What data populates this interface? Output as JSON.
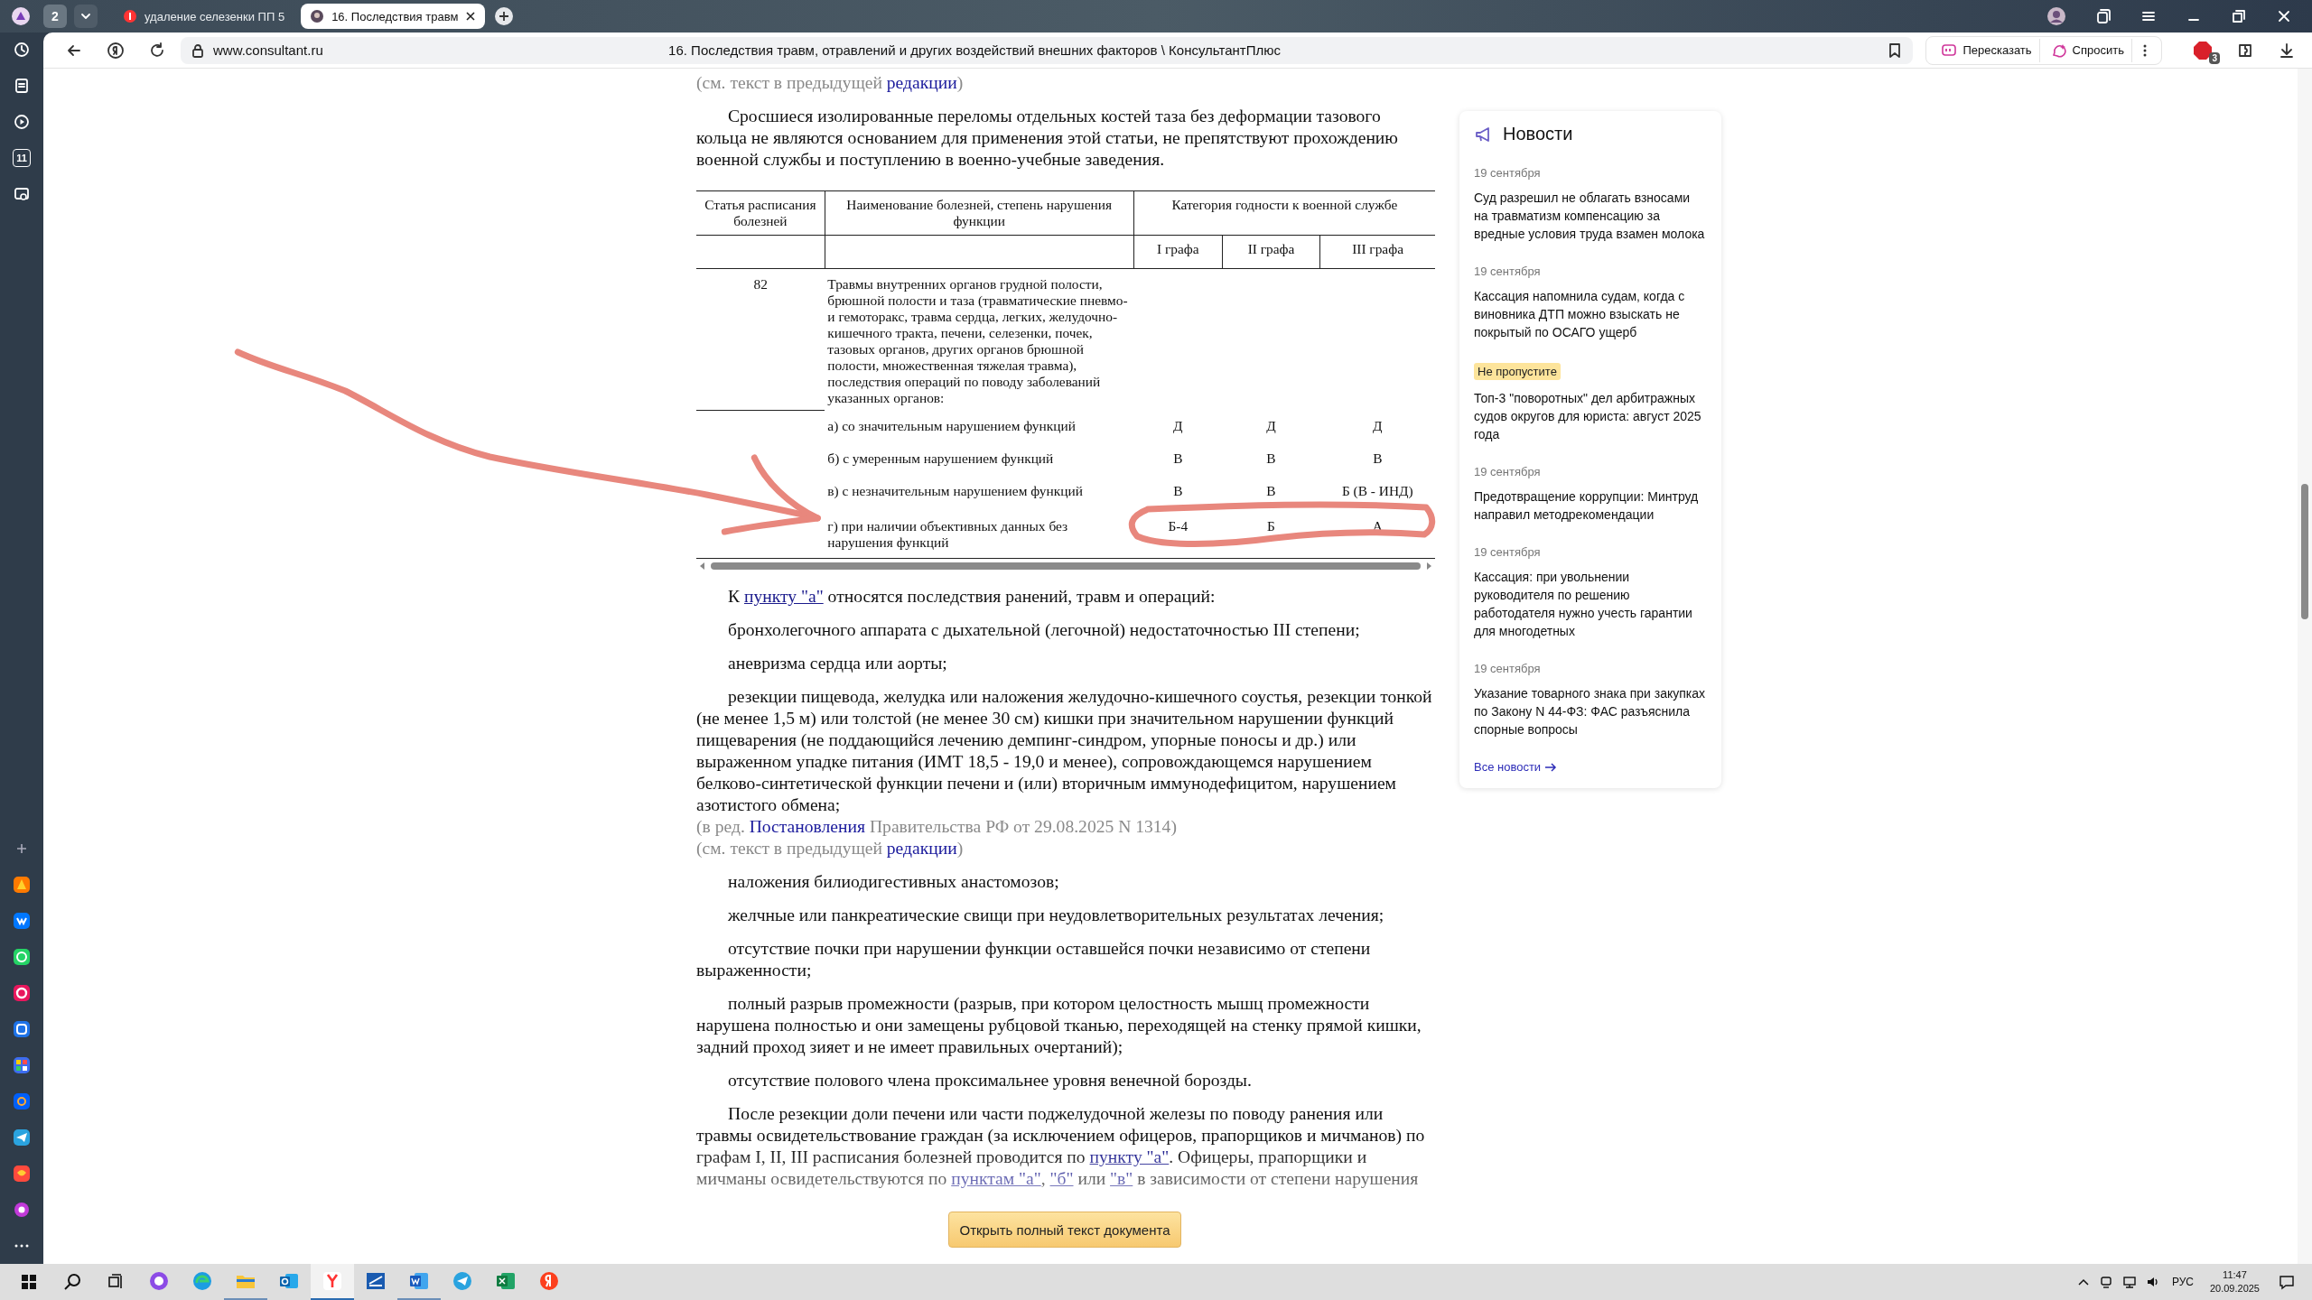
{
  "browser": {
    "tab_count": "2",
    "tabs": [
      {
        "title": "удаление селезенки ПП 5",
        "selected": false
      },
      {
        "title": "16. Последствия травм",
        "selected": true
      }
    ],
    "url": "www.consultant.ru",
    "page_title": "16. Последствия травм, отравлений и других воздействий внешних факторов \\ КонсультантПлюс",
    "actions": [
      "Пересказать",
      "Спросить"
    ],
    "extension_badge": "3"
  },
  "sidebar": {
    "calendar_day": "11"
  },
  "document": {
    "blocks": [
      {
        "kind": "note",
        "parts": [
          {
            "text": "(см. текст в предыдущей "
          },
          {
            "link": "редакции"
          },
          {
            "text": ")"
          }
        ]
      },
      {
        "kind": "para",
        "parts": [
          {
            "text": "Сросшиеся изолированные переломы отдельных костей таза без деформации тазового кольца не являются основанием для применения этой статьи, не препятствуют прохождению военной службы и поступлению в военно-учебные заведения."
          }
        ]
      },
      {
        "kind": "table"
      },
      {
        "kind": "para",
        "parts": [
          {
            "text": "К "
          },
          {
            "link": "пункту \"а\""
          },
          {
            "text": " относятся последствия ранений, травм и операций:"
          }
        ]
      },
      {
        "kind": "para",
        "parts": [
          {
            "text": "бронхолегочного аппарата с дыхательной (легочной) недостаточностью III степени;"
          }
        ]
      },
      {
        "kind": "para",
        "parts": [
          {
            "text": "аневризма сердца или аорты;"
          }
        ]
      },
      {
        "kind": "para",
        "parts": [
          {
            "text": "резекции пищевода, желудка или наложения желудочно-кишечного соустья, резекции тонкой (не менее 1,5 м) или толстой (не менее 30 см) кишки при значительном нарушении функций пищеварения (не поддающийся лечению демпинг-синдром, упорные поносы и др.) или выраженном упадке питания (ИМТ 18,5 - 19,0 и менее), сопровождающемся нарушением белково-синтетической функции печени и (или) вторичным иммунодефицитом, нарушением азотистого обмена;"
          }
        ]
      },
      {
        "kind": "note",
        "parts": [
          {
            "text": "(в ред. "
          },
          {
            "link": "Постановления"
          },
          {
            "text": " Правительства РФ от 29.08.2025 N 1314)"
          }
        ]
      },
      {
        "kind": "note",
        "parts": [
          {
            "text": "(см. текст в предыдущей "
          },
          {
            "link": "редакции"
          },
          {
            "text": ")"
          }
        ]
      },
      {
        "kind": "para",
        "parts": [
          {
            "text": "наложения билиодигестивных анастомозов;"
          }
        ]
      },
      {
        "kind": "para",
        "parts": [
          {
            "text": "желчные или панкреатические свищи при неудовлетворительных результатах лечения;"
          }
        ]
      },
      {
        "kind": "para",
        "parts": [
          {
            "text": "отсутствие почки при нарушении функции оставшейся почки независимо от степени выраженности;"
          }
        ]
      },
      {
        "kind": "para",
        "parts": [
          {
            "text": "полный разрыв промежности (разрыв, при котором целостность мышц промежности нарушена полностью и они замещены рубцовой тканью, переходящей на стенку прямой кишки, задний проход зияет и не имеет правильных очертаний);"
          }
        ]
      },
      {
        "kind": "para",
        "parts": [
          {
            "text": "отсутствие полового члена проксимальнее уровня венечной борозды."
          }
        ]
      },
      {
        "kind": "para",
        "parts": [
          {
            "text": "После резекции доли печени или части поджелудочной железы по поводу ранения или травмы освидетельствование граждан (за исключением офицеров, прапорщиков и мичманов) по графам I, II, III расписания болезней проводится по "
          },
          {
            "link": "пункту \"а\""
          },
          {
            "text": ". Офицеры, прапорщики и мичманы освидетельствуются по "
          },
          {
            "link": "пунктам \"а\""
          },
          {
            "text": ", "
          },
          {
            "link": "\"б\""
          },
          {
            "text": " или "
          },
          {
            "link": "\"в\""
          },
          {
            "text": " в зависимости от степени нарушения"
          }
        ]
      }
    ]
  },
  "table": {
    "head": [
      "Статья расписания болезней",
      "Наименование болезней, степень нарушения функции",
      "Категория годности к военной службе"
    ],
    "grades": [
      "I графа",
      "II графа",
      "III графа"
    ],
    "article": "82",
    "description": "Травмы внутренних органов грудной полости, брюшной полости и таза (травматические пневмо- и гемоторакс, травма сердца, легких, желудочно-кишечного тракта, печени, селезенки, почек, тазовых органов, других органов брюшной полости, множественная тяжелая травма), последствия операций по поводу заболеваний указанных органов:",
    "rows": [
      {
        "label": "а) со значительным нарушением функций",
        "values": [
          "Д",
          "Д",
          "Д"
        ]
      },
      {
        "label": "б) с умеренным нарушением функций",
        "values": [
          "В",
          "В",
          "В"
        ]
      },
      {
        "label": "в) с незначительным нарушением функций",
        "values": [
          "В",
          "В",
          "Б (В - ИНД)"
        ]
      },
      {
        "label": "г) при наличии объективных данных без нарушения функций",
        "values": [
          "Б-4",
          "Б",
          "А"
        ]
      }
    ]
  },
  "open_button": "Открыть полный текст документа",
  "news": {
    "title": "Новости",
    "items": [
      {
        "kind": "dated",
        "date": "19 сентября",
        "headline": "Суд разрешил не облагать взносами на травматизм компенсацию за вредные условия труда взамен молока"
      },
      {
        "kind": "dated",
        "date": "19 сентября",
        "headline": "Кассация напомнила судам, когда с виновника ДТП можно взыскать не покрытый по ОСАГО ущерб"
      },
      {
        "kind": "featured",
        "badge": "Не пропустите",
        "headline": "Топ-3 \"поворотных\" дел арбитражных судов округов для юриста: август 2025 года"
      },
      {
        "kind": "dated",
        "date": "19 сентября",
        "headline": "Предотвращение коррупции: Минтруд направил методрекомендации"
      },
      {
        "kind": "dated",
        "date": "19 сентября",
        "headline": "Кассация: при увольнении руководителя по решению работодателя нужно учесть гарантии для многодетных"
      },
      {
        "kind": "dated",
        "date": "19 сентября",
        "headline": "Указание товарного знака при закупках по Закону N 44-ФЗ: ФАС разъяснила спорные вопросы"
      }
    ],
    "all_link": "Все новости"
  },
  "annotations": {
    "arrow": {
      "color": "#e8877d"
    },
    "ellipse": {
      "color": "#e8877d"
    }
  },
  "taskbar": {
    "apps": [
      {
        "kind": "assistant",
        "running": false,
        "selected": false
      },
      {
        "kind": "edge",
        "running": false,
        "selected": false
      },
      {
        "kind": "folder",
        "running": true,
        "selected": false
      },
      {
        "kind": "mail",
        "running": false,
        "selected": false
      },
      {
        "kind": "ybrowser",
        "running": true,
        "selected": true
      },
      {
        "kind": "scanner",
        "running": false,
        "selected": false
      },
      {
        "kind": "word",
        "running": true,
        "selected": false
      },
      {
        "kind": "telegram",
        "running": false,
        "selected": false
      },
      {
        "kind": "excel",
        "running": false,
        "selected": false
      },
      {
        "kind": "yandex",
        "running": false,
        "selected": false
      }
    ],
    "language": "РУС",
    "time": "11:47",
    "date": "20.09.2025"
  }
}
